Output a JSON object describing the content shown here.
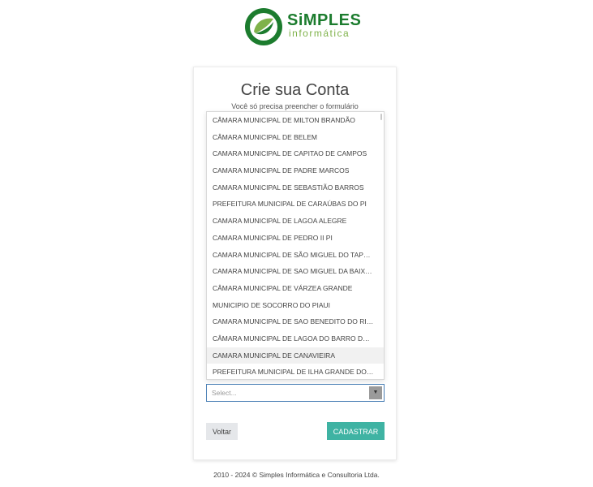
{
  "brand": {
    "name": "SiMPLES",
    "tagline": "informática",
    "color_primary": "#1c7c2e",
    "color_secondary": "#7fb24a"
  },
  "form": {
    "title": "Crie sua Conta",
    "subtitle": "Você só precisa preencher o formulário",
    "select_placeholder": "Select...",
    "back_label": "Voltar",
    "submit_label": "CADASTRAR",
    "submit_color": "#3fb3a3"
  },
  "dropdown": {
    "highlighted_index": 14,
    "options": [
      "CÂMARA MUNICIPAL DE MILTON BRANDÃO",
      "CÂMARA MUNICIPAL DE BELEM",
      "CAMARA MUNICIPAL DE CAPITAO DE CAMPOS",
      "CAMARA MUNICIPAL DE PADRE MARCOS",
      "CAMARA MUNICIPAL DE SEBASTIÃO BARROS",
      "PREFEITURA MUNICIPAL DE CARAÚBAS DO PI",
      "CAMARA MUNICIPAL DE LAGOA ALEGRE",
      "CAMARA MUNICIPAL DE PEDRO II PI",
      "CAMARA MUNICIPAL DE SÃO MIGUEL DO TAPUIO",
      "CAMARA MUNICIPAL DE SAO MIGUEL DA BAIXA GRANDE",
      "CÂMARA MUNICIPAL DE VÁRZEA GRANDE",
      "MUNICIPIO DE SOCORRO DO PIAUI",
      "CAMARA MUNICIPAL DE SAO BENEDITO DO RIO PRETO",
      "CÂMARA MUNICIPAL DE LAGOA DO BARRO DO PIAUI",
      "CAMARA MUNICIPAL DE CANAVIEIRA",
      "PREFEITURA MUNICIPAL DE ILHA GRANDE DO PI"
    ]
  },
  "footer": {
    "text": "2010 - 2024  © Simples Informática e Consultoria Ltda."
  }
}
